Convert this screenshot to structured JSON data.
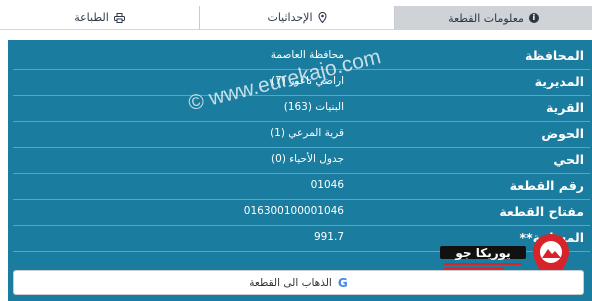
{
  "tabs": [
    {
      "label": "معلومات القطعة",
      "icon": "info-icon",
      "active": true
    },
    {
      "label": "الإحداثيات",
      "icon": "location-pin-icon",
      "active": false
    },
    {
      "label": "الطباعة",
      "icon": "printer-icon",
      "active": false
    }
  ],
  "rows": [
    {
      "label": "المحافظة",
      "value": "محافظة العاصمة"
    },
    {
      "label": "المديرية",
      "value": "اراضي ناعور (7)"
    },
    {
      "label": "القرية",
      "value": "البنيات (163)"
    },
    {
      "label": "الحوض",
      "value": "قرية المرعي (1)"
    },
    {
      "label": "الحي",
      "value": "جدول الأحياء (0)"
    },
    {
      "label": "رقم القطعة",
      "value": "01046"
    },
    {
      "label": "مفتاح القطعة",
      "value": "016300100001046"
    },
    {
      "label": "**المساحة",
      "value": "991.7"
    }
  ],
  "goto_button": {
    "label": "الذهاب الى القطعة",
    "icon": "google-icon"
  },
  "watermark": {
    "text": "© www.eurekajo.com",
    "logo_text": "يوريكا جو"
  },
  "colors": {
    "panel": "#1a7c9e",
    "active_tab": "#cfd3d7",
    "logo_red": "#d8232a"
  }
}
